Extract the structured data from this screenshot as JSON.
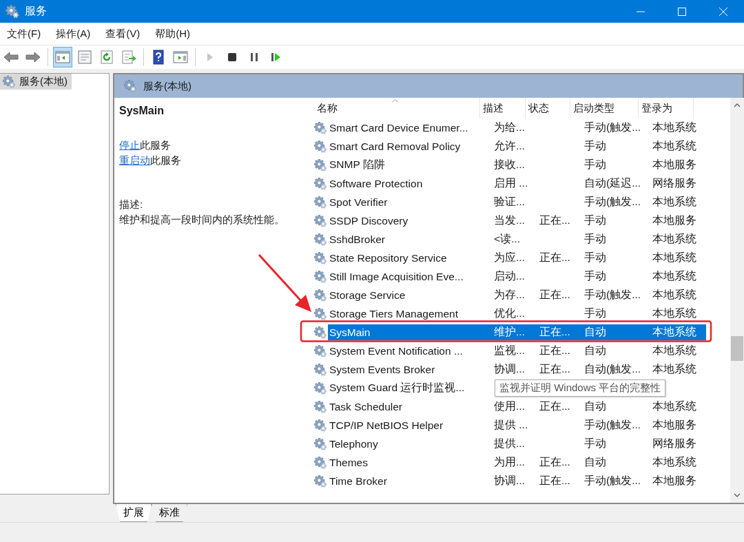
{
  "window": {
    "title": "服务"
  },
  "menu": [
    "文件(F)",
    "操作(A)",
    "查看(V)",
    "帮助(H)"
  ],
  "toolbar": [
    {
      "kind": "back",
      "selected": false,
      "disabled": false
    },
    {
      "kind": "forward",
      "selected": false,
      "disabled": false
    },
    {
      "kind": "sep"
    },
    {
      "kind": "tree",
      "selected": true,
      "disabled": false
    },
    {
      "kind": "properties",
      "selected": false,
      "disabled": false
    },
    {
      "kind": "refresh",
      "selected": false,
      "disabled": false
    },
    {
      "kind": "export",
      "selected": false,
      "disabled": false
    },
    {
      "kind": "sep"
    },
    {
      "kind": "help",
      "selected": false,
      "disabled": false
    },
    {
      "kind": "pane",
      "selected": false,
      "disabled": false
    },
    {
      "kind": "sep"
    },
    {
      "kind": "play",
      "selected": false,
      "disabled": true
    },
    {
      "kind": "stop",
      "selected": false,
      "disabled": false
    },
    {
      "kind": "pause",
      "selected": false,
      "disabled": false
    },
    {
      "kind": "resume",
      "selected": false,
      "disabled": false
    }
  ],
  "tree": [
    {
      "label": "服务(本地)",
      "selected": true
    }
  ],
  "panel": {
    "title": "服务(本地)"
  },
  "details": {
    "name": "SysMain",
    "actions": [
      {
        "link": "停止",
        "text": "此服务"
      },
      {
        "link": "重启动",
        "text": "此服务"
      }
    ],
    "description_label": "描述:",
    "description": "维护和提高一段时间内的系统性能。"
  },
  "table": {
    "columns": [
      "名称",
      "描述",
      "状态",
      "启动类型",
      "登录为"
    ],
    "rows": [
      {
        "name": "Smart Card Device Enumer...",
        "desc": "为给...",
        "status": "",
        "type": "手动(触发...",
        "login": "本地系统",
        "selected": false
      },
      {
        "name": "Smart Card Removal Policy",
        "desc": "允许...",
        "status": "",
        "type": "手动",
        "login": "本地系统",
        "selected": false
      },
      {
        "name": "SNMP 陷阱",
        "desc": "接收...",
        "status": "",
        "type": "手动",
        "login": "本地服务",
        "selected": false
      },
      {
        "name": "Software Protection",
        "desc": "启用 ...",
        "status": "",
        "type": "自动(延迟...",
        "login": "网络服务",
        "selected": false
      },
      {
        "name": "Spot Verifier",
        "desc": "验证...",
        "status": "",
        "type": "手动(触发...",
        "login": "本地系统",
        "selected": false
      },
      {
        "name": "SSDP Discovery",
        "desc": "当发...",
        "status": "正在...",
        "type": "手动",
        "login": "本地服务",
        "selected": false
      },
      {
        "name": "SshdBroker",
        "desc": "<读...",
        "status": "",
        "type": "手动",
        "login": "本地系统",
        "selected": false
      },
      {
        "name": "State Repository Service",
        "desc": "为应...",
        "status": "正在...",
        "type": "手动",
        "login": "本地系统",
        "selected": false
      },
      {
        "name": "Still Image Acquisition Eve...",
        "desc": "启动...",
        "status": "",
        "type": "手动",
        "login": "本地系统",
        "selected": false
      },
      {
        "name": "Storage Service",
        "desc": "为存...",
        "status": "正在...",
        "type": "手动(触发...",
        "login": "本地系统",
        "selected": false
      },
      {
        "name": "Storage Tiers Management",
        "desc": "优化...",
        "status": "",
        "type": "手动",
        "login": "本地系统",
        "selected": false
      },
      {
        "name": "SysMain",
        "desc": "维护...",
        "status": "正在...",
        "type": "自动",
        "login": "本地系统",
        "selected": true
      },
      {
        "name": "System Event Notification ...",
        "desc": "监视...",
        "status": "正在...",
        "type": "自动",
        "login": "本地系统",
        "selected": false
      },
      {
        "name": "System Events Broker",
        "desc": "协调...",
        "status": "正在...",
        "type": "自动(触发...",
        "login": "本地系统",
        "selected": false
      },
      {
        "name": "System Guard 运行时监视...",
        "desc": "",
        "status": "",
        "type": "",
        "login": "",
        "selected": false,
        "tooltip": "监视并证明 Windows 平台的完整性"
      },
      {
        "name": "Task Scheduler",
        "desc": "使用...",
        "status": "正在...",
        "type": "自动",
        "login": "本地系统",
        "selected": false
      },
      {
        "name": "TCP/IP NetBIOS Helper",
        "desc": "提供 ...",
        "status": "",
        "type": "手动(触发...",
        "login": "本地服务",
        "selected": false
      },
      {
        "name": "Telephony",
        "desc": "提供...",
        "status": "",
        "type": "手动",
        "login": "网络服务",
        "selected": false
      },
      {
        "name": "Themes",
        "desc": "为用...",
        "status": "正在...",
        "type": "自动",
        "login": "本地系统",
        "selected": false
      },
      {
        "name": "Time Broker",
        "desc": "协调...",
        "status": "正在...",
        "type": "手动(触发...",
        "login": "本地服务",
        "selected": false
      }
    ]
  },
  "bottom_tabs": [
    {
      "label": "扩展",
      "selected": true
    },
    {
      "label": "标准",
      "selected": false
    }
  ]
}
